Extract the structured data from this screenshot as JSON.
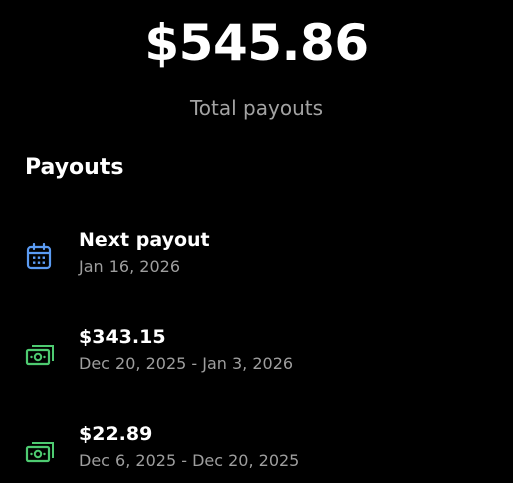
{
  "summary": {
    "total_amount": "$545.86",
    "total_label": "Total payouts"
  },
  "payouts": {
    "section_title": "Payouts",
    "next": {
      "title": "Next payout",
      "date": "Jan 16, 2026",
      "icon": "calendar-icon",
      "icon_color": "#5b9bf3"
    },
    "items": [
      {
        "amount": "$343.15",
        "period": "Dec 20, 2025 - Jan 3, 2026",
        "icon": "cash-icon",
        "icon_color": "#4ecb71"
      },
      {
        "amount": "$22.89",
        "period": "Dec 6, 2025 - Dec 20, 2025",
        "icon": "cash-icon",
        "icon_color": "#4ecb71"
      }
    ]
  }
}
